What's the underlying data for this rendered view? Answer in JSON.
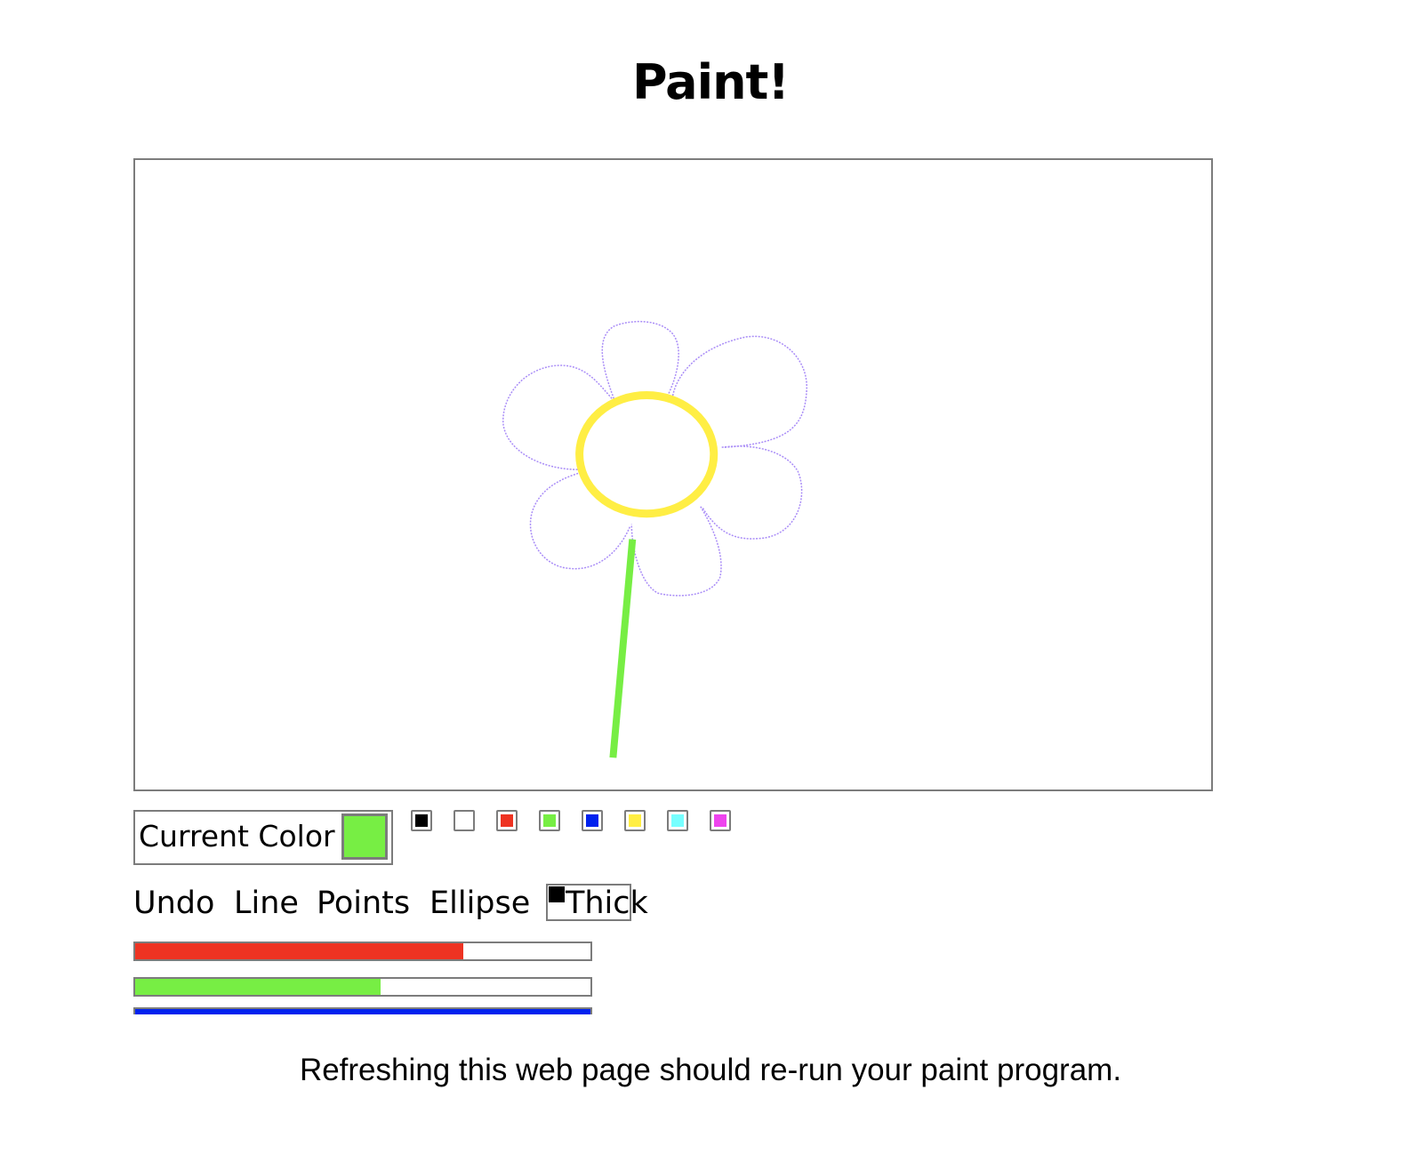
{
  "page": {
    "title": "Paint!",
    "footer_text": "Refreshing this web page should re-run your paint program."
  },
  "canvas": {
    "drawing": [
      {
        "shape": "petal-outline",
        "color": "#a98cf7"
      },
      {
        "shape": "ellipse",
        "color": "#ffee44"
      },
      {
        "shape": "line",
        "color": "#77ee44"
      }
    ]
  },
  "current_color": {
    "label": "Current Color",
    "value": "#77ee44"
  },
  "palette": [
    {
      "name": "black",
      "color": "#000000"
    },
    {
      "name": "white",
      "color": "#ffffff"
    },
    {
      "name": "red",
      "color": "#ee3322"
    },
    {
      "name": "green",
      "color": "#77ee44"
    },
    {
      "name": "blue",
      "color": "#0022ee"
    },
    {
      "name": "yellow",
      "color": "#ffee44"
    },
    {
      "name": "cyan",
      "color": "#77ffff"
    },
    {
      "name": "magenta",
      "color": "#ee44ee"
    }
  ],
  "tools": {
    "undo": "Undo",
    "line": "Line",
    "points": "Points",
    "ellipse": "Ellipse",
    "thick": "Thick"
  },
  "sliders": {
    "red": {
      "color": "#ee3322",
      "fraction": 0.72
    },
    "green": {
      "color": "#77ee44",
      "fraction": 0.54
    },
    "blue": {
      "color": "#0022ee",
      "fraction": 1.0
    }
  }
}
